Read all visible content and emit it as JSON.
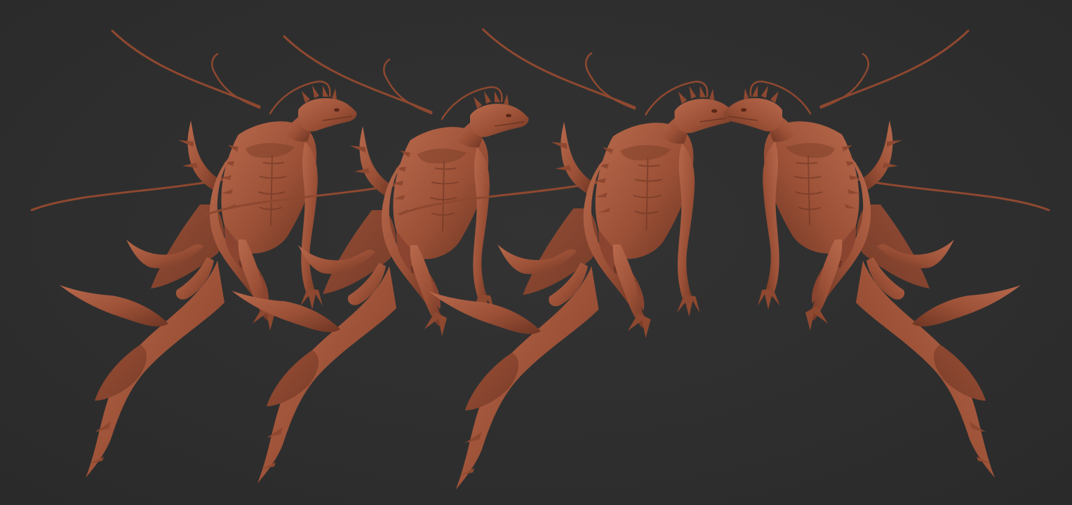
{
  "scene": {
    "background_color": "#2e2e2e",
    "clay_color": "#a0553b",
    "clay_shadow": "#6e3523",
    "clay_highlight": "#c0745a",
    "views": [
      {
        "name": "three-quarter-left-view",
        "flip": false
      },
      {
        "name": "front-view",
        "flip": false
      },
      {
        "name": "back-view",
        "flip": false
      },
      {
        "name": "mirrored-three-quarter-view",
        "flip": true
      }
    ]
  }
}
